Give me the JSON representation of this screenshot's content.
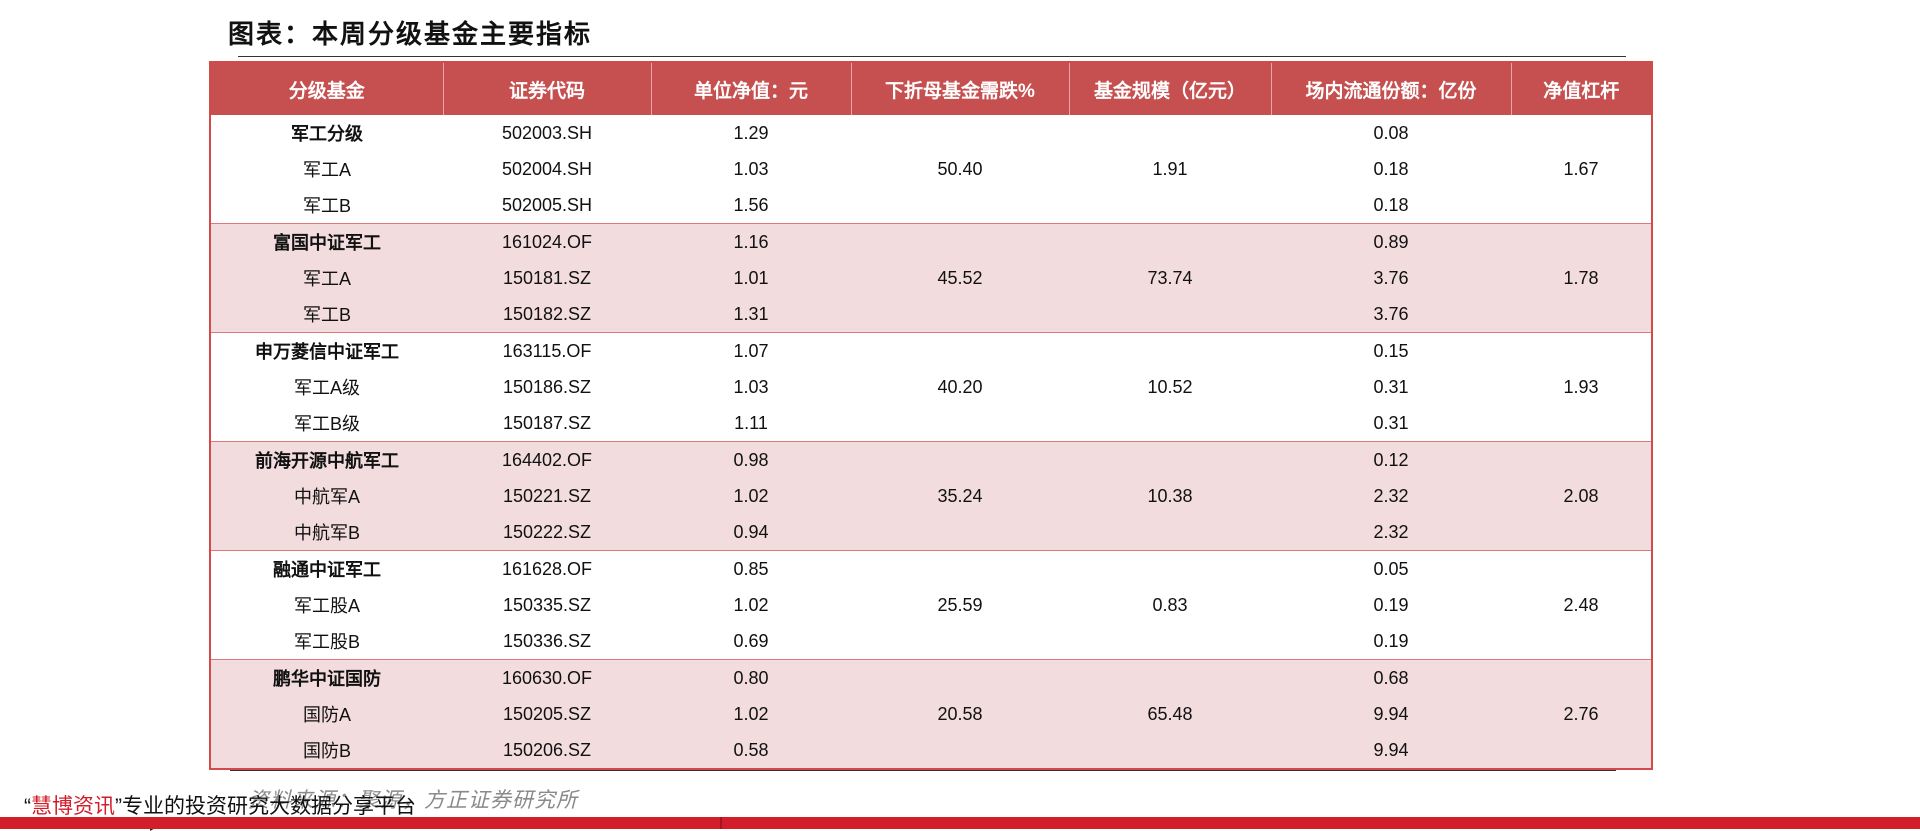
{
  "title": "图表：本周分级基金主要指标",
  "table": {
    "headers": [
      "分级基金",
      "证券代码",
      "单位净值：元",
      "下折母基金需跌%",
      "基金规模（亿元）",
      "场内流通份额：亿份",
      "净值杠杆"
    ],
    "groups": [
      {
        "rows": [
          {
            "fund": "军工分级",
            "code": "502003.SH",
            "nav": "1.29",
            "share": "0.08"
          },
          {
            "fund": "军工A",
            "code": "502004.SH",
            "nav": "1.03",
            "share": "0.18"
          },
          {
            "fund": "军工B",
            "code": "502005.SH",
            "nav": "1.56",
            "share": "0.18"
          }
        ],
        "drop": "50.40",
        "scale": "1.91",
        "leverage": "1.67"
      },
      {
        "rows": [
          {
            "fund": "富国中证军工",
            "code": "161024.OF",
            "nav": "1.16",
            "share": "0.89"
          },
          {
            "fund": "军工A",
            "code": "150181.SZ",
            "nav": "1.01",
            "share": "3.76"
          },
          {
            "fund": "军工B",
            "code": "150182.SZ",
            "nav": "1.31",
            "share": "3.76"
          }
        ],
        "drop": "45.52",
        "scale": "73.74",
        "leverage": "1.78"
      },
      {
        "rows": [
          {
            "fund": "申万菱信中证军工",
            "code": "163115.OF",
            "nav": "1.07",
            "share": "0.15"
          },
          {
            "fund": "军工A级",
            "code": "150186.SZ",
            "nav": "1.03",
            "share": "0.31"
          },
          {
            "fund": "军工B级",
            "code": "150187.SZ",
            "nav": "1.11",
            "share": "0.31"
          }
        ],
        "drop": "40.20",
        "scale": "10.52",
        "leverage": "1.93"
      },
      {
        "rows": [
          {
            "fund": "前海开源中航军工",
            "code": "164402.OF",
            "nav": "0.98",
            "share": "0.12"
          },
          {
            "fund": "中航军A",
            "code": "150221.SZ",
            "nav": "1.02",
            "share": "2.32"
          },
          {
            "fund": "中航军B",
            "code": "150222.SZ",
            "nav": "0.94",
            "share": "2.32"
          }
        ],
        "drop": "35.24",
        "scale": "10.38",
        "leverage": "2.08"
      },
      {
        "rows": [
          {
            "fund": "融通中证军工",
            "code": "161628.OF",
            "nav": "0.85",
            "share": "0.05"
          },
          {
            "fund": "军工股A",
            "code": "150335.SZ",
            "nav": "1.02",
            "share": "0.19"
          },
          {
            "fund": "军工股B",
            "code": "150336.SZ",
            "nav": "0.69",
            "share": "0.19"
          }
        ],
        "drop": "25.59",
        "scale": "0.83",
        "leverage": "2.48"
      },
      {
        "rows": [
          {
            "fund": "鹏华中证国防",
            "code": "160630.OF",
            "nav": "0.80",
            "share": "0.68"
          },
          {
            "fund": "国防A",
            "code": "150205.SZ",
            "nav": "1.02",
            "share": "9.94"
          },
          {
            "fund": "国防B",
            "code": "150206.SZ",
            "nav": "0.58",
            "share": "9.94"
          }
        ],
        "drop": "20.58",
        "scale": "65.48",
        "leverage": "2.76"
      }
    ]
  },
  "source": "资料来源：聚源，方正证券研究所",
  "banner": {
    "open_quote": "“",
    "brand": "慧博资讯",
    "close_quote": "”",
    "tagline": "专业的投资研究大数据分享平台"
  },
  "colors": {
    "header_bg": "#c65050",
    "alt_row_bg": "#f2dcde",
    "brand_red": "#d21e2b"
  }
}
